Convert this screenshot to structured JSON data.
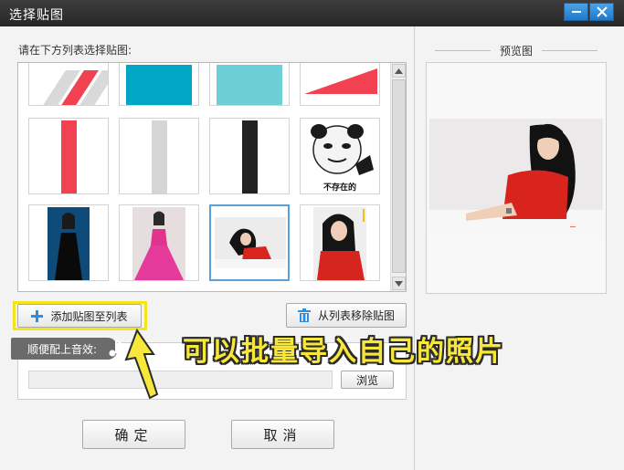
{
  "window": {
    "title": "选择贴图",
    "minimize_icon": "minimize-icon",
    "close_icon": "close-icon",
    "accent_color": "#2f8de0"
  },
  "list": {
    "prompt": "请在下方列表选择贴图:",
    "tiles": [
      {
        "kind": "diagonal-stripes"
      },
      {
        "kind": "teal-block",
        "color": "#00a6c4"
      },
      {
        "kind": "light-teal-block",
        "color": "#6ccfd6"
      },
      {
        "kind": "red-triangle",
        "color": "#f24150"
      },
      {
        "kind": "red-bar",
        "color": "#f24150"
      },
      {
        "kind": "gray-bar",
        "color": "#d5d5d5"
      },
      {
        "kind": "black-bar",
        "color": "#222222"
      },
      {
        "kind": "meme",
        "caption": "不存在的"
      },
      {
        "kind": "photo-black-dress"
      },
      {
        "kind": "photo-pink-dress"
      },
      {
        "kind": "photo-red-reclining",
        "selected": true
      },
      {
        "kind": "photo-red-portrait"
      }
    ]
  },
  "buttons": {
    "add_label": "添加贴图至列表",
    "add_icon": "plus-icon",
    "remove_label": "从列表移除贴图",
    "remove_icon": "trash-icon",
    "browse_label": "浏览",
    "ok_label": "确定",
    "cancel_label": "取消"
  },
  "music": {
    "label": "顺便配上音效:",
    "icon": "music-note-icon",
    "path_value": ""
  },
  "preview": {
    "title": "预览图"
  },
  "annotation": {
    "text": "可以批量导入自己的照片",
    "color": "#f6e73a"
  }
}
